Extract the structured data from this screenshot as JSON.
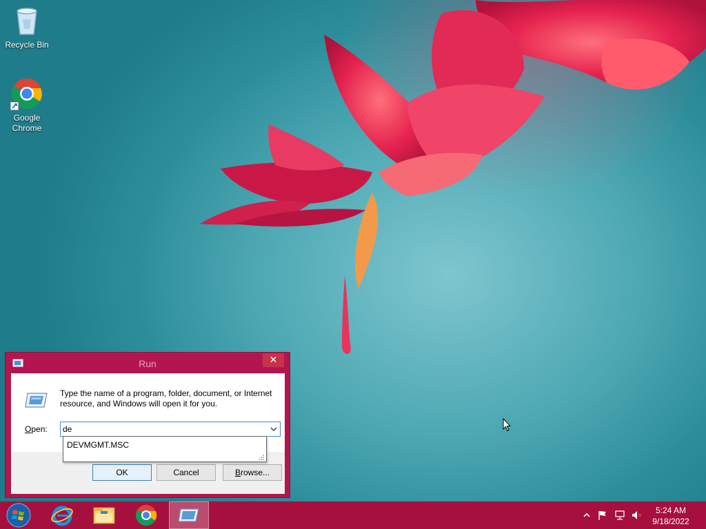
{
  "desktop": {
    "icons": [
      {
        "label": "Recycle Bin",
        "icon": "recycle-bin-icon"
      },
      {
        "label": "Google Chrome",
        "icon": "chrome-icon"
      }
    ]
  },
  "run_dialog": {
    "title": "Run",
    "close_glyph": "✕",
    "description": "Type the name of a program, folder, document, or Internet resource, and Windows will open it for you.",
    "open_label_accel": "O",
    "open_label_rest": "pen:",
    "open_value": "de",
    "autocomplete_item": "DEVMGMT.MSC",
    "ok_label": "OK",
    "cancel_label": "Cancel",
    "browse_label_accel": "B",
    "browse_label_rest": "rowse..."
  },
  "taskbar": {
    "items": [
      "start-icon",
      "internet-explorer-icon",
      "file-explorer-icon",
      "chrome-icon",
      "run-icon"
    ],
    "active_item": "run-icon",
    "time": "5:24 AM",
    "date": "9/18/2022"
  },
  "colors": {
    "accent": "#a5103f",
    "dialog_frame": "#b3164f",
    "close_button": "#c7334b"
  }
}
